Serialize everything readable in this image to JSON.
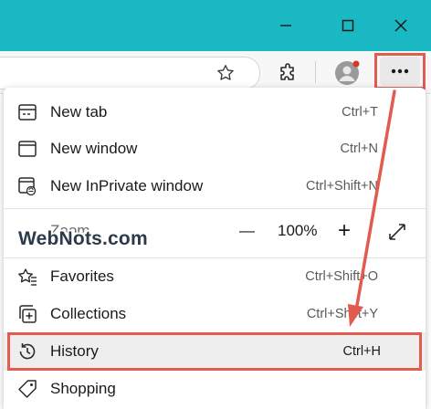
{
  "window": {
    "minimize_icon": "minimize-icon",
    "maximize_icon": "maximize-icon",
    "close_icon": "close-icon"
  },
  "toolbar": {
    "favorite_icon": "star-icon",
    "extensions_icon": "puzzle-icon",
    "profile_icon": "profile-avatar-icon",
    "more_icon": "ellipsis-icon"
  },
  "menu": {
    "items": [
      {
        "label": "New tab",
        "shortcut": "Ctrl+T",
        "icon": "new-tab-icon"
      },
      {
        "label": "New window",
        "shortcut": "Ctrl+N",
        "icon": "new-window-icon"
      },
      {
        "label": "New InPrivate window",
        "shortcut": "Ctrl+Shift+N",
        "icon": "inprivate-icon"
      },
      {
        "label": "Zoom",
        "icon": "zoom-row"
      },
      {
        "label": "Favorites",
        "shortcut": "Ctrl+Shift+O",
        "icon": "favorites-icon"
      },
      {
        "label": "Collections",
        "shortcut": "Ctrl+Shift+Y",
        "icon": "collections-icon"
      },
      {
        "label": "History",
        "shortcut": "Ctrl+H",
        "icon": "history-icon"
      },
      {
        "label": "Shopping",
        "icon": "shopping-tag-icon"
      }
    ],
    "zoom": {
      "minus": "—",
      "value": "100%",
      "plus": "+",
      "fullscreen_icon": "fullscreen-icon"
    }
  },
  "watermark": "WebNots.com",
  "colors": {
    "titlebar": "#1ab8c3",
    "highlight": "#e25b4f"
  }
}
